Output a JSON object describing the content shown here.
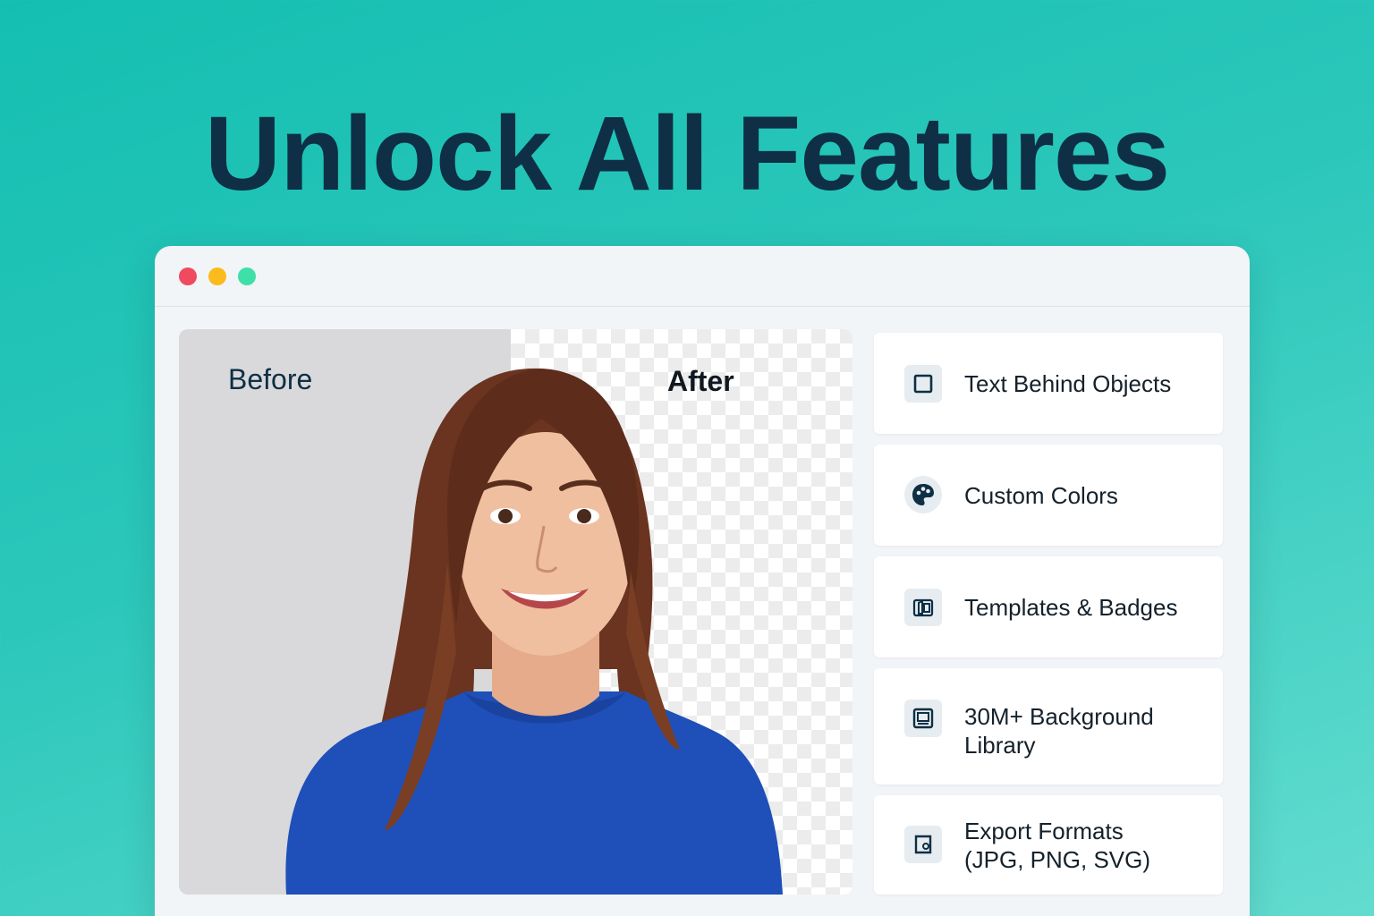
{
  "headline": "Unlock All Features",
  "window": {
    "traffic_lights": {
      "close_color": "#f04a5e",
      "minimize_color": "#fbbb1c",
      "zoom_color": "#3fdfa8"
    }
  },
  "preview": {
    "before_label": "Before",
    "after_label": "After",
    "colors": {
      "hair": "#6a3420",
      "skin": "#f0bfa0",
      "sweater": "#1f4fb8"
    }
  },
  "features": [
    {
      "label": "Text Behind Objects",
      "icon": "square-outline-icon"
    },
    {
      "label": "Custom Colors",
      "icon": "palette-icon"
    },
    {
      "label": "Templates & Badges",
      "icon": "template-icon"
    },
    {
      "label": "30M+ Background\nLibrary",
      "icon": "image-frame-icon"
    },
    {
      "label": "Export Formats\n(JPG, PNG, SVG)",
      "icon": "export-file-icon"
    }
  ],
  "colors": {
    "headline": "#0e2f45",
    "icon": "#0e2f45",
    "card_bg": "#ffffff"
  }
}
